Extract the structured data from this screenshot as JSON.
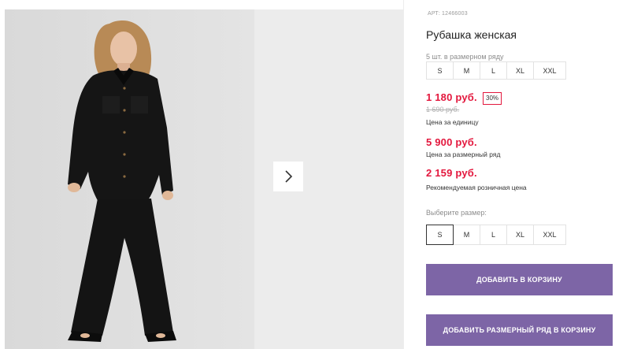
{
  "gallery": {
    "next_icon": "chevron-right-icon"
  },
  "product": {
    "sku_label": "АРТ:",
    "sku_value": "12466003",
    "title": "Рубашка женская",
    "pack_note": "5 шт. в размерном ряду",
    "pack_sizes": [
      "S",
      "M",
      "L",
      "XL",
      "XXL"
    ],
    "unit_price": "1 180 руб.",
    "discount": "30%",
    "old_price": "1 690 руб.",
    "unit_price_caption": "Цена за единицу",
    "row_price": "5 900 руб.",
    "row_price_caption": "Цена за размерный ряд",
    "retail_price": "2 159 руб.",
    "retail_price_caption": "Рекомендуемая розничная цена",
    "choose_size_label": "Выберите размер:",
    "selected_size": "S",
    "choose_sizes": [
      "S",
      "M",
      "L",
      "XL",
      "XXL"
    ],
    "add_to_cart": "ДОБАВИТЬ В КОРЗИНУ",
    "add_row_to_cart": "ДОБАВИТЬ РАЗМЕРНЫЙ РЯД В КОРЗИНУ"
  },
  "colors": {
    "accent": "#7d65a6",
    "price_red": "#e3173d"
  }
}
